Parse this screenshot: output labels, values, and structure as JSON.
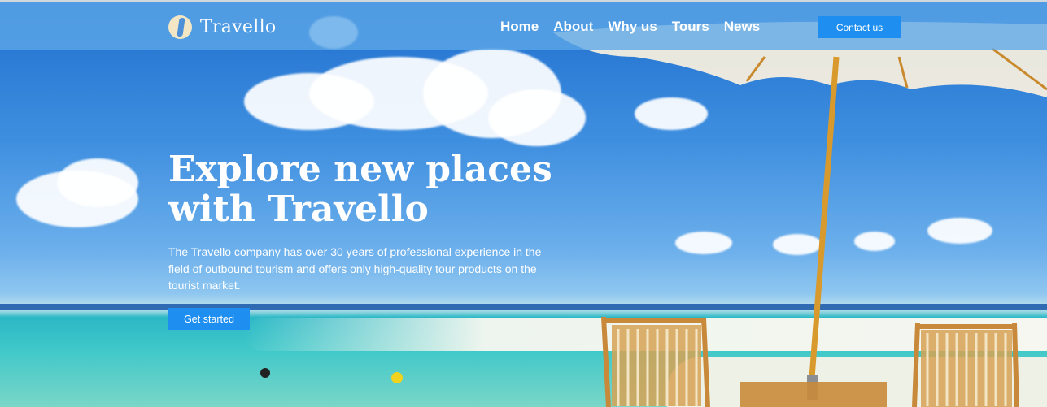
{
  "brand": {
    "name": "Travello",
    "logo_icon": "travello-logo-icon"
  },
  "nav": {
    "items": [
      "Home",
      "About",
      "Why us",
      "Tours",
      "News"
    ],
    "contact_label": "Contact us"
  },
  "hero": {
    "title": "Explore new places with Travello",
    "description": "The Travello company has over 30 years of professional experience in the field of outbound tourism and offers only high-quality tour products on the tourist market.",
    "cta_label": "Get started",
    "image": "beach-umbrella-chairs-photo"
  },
  "colors": {
    "accent": "#1e8ff0",
    "navbar": "#5ea8e8",
    "logo": "#f2e6c4"
  }
}
